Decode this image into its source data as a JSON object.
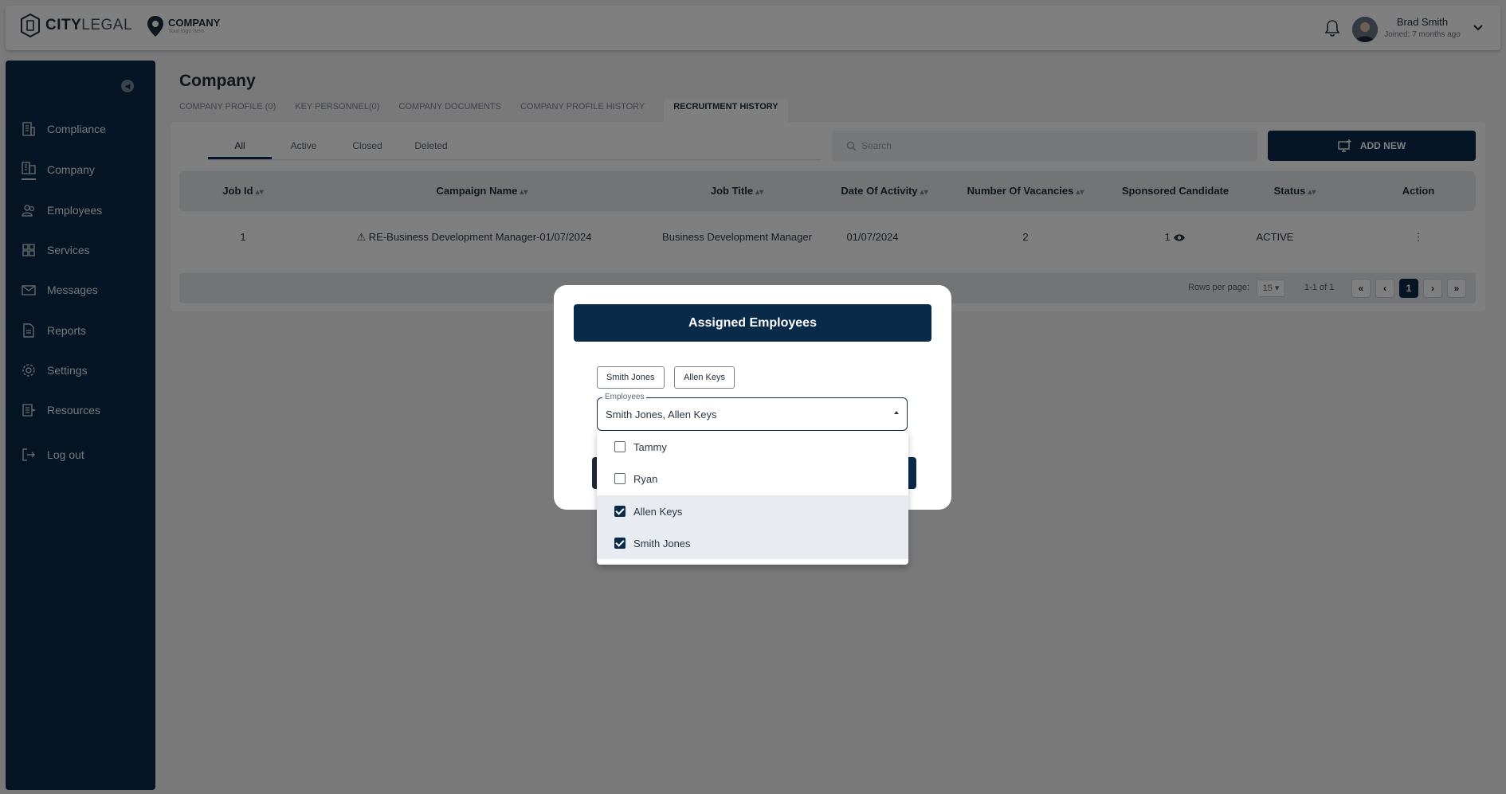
{
  "brand": {
    "name_bold": "CITY",
    "name_light": "LEGAL"
  },
  "company_logo": {
    "name": "COMPANY",
    "tagline": "Your logo here"
  },
  "user": {
    "name": "Brad Smith",
    "joined": "Joined: 7 months ago"
  },
  "sidebar": {
    "items": [
      {
        "label": "Compliance",
        "icon": "compliance-icon"
      },
      {
        "label": "Company",
        "icon": "company-icon"
      },
      {
        "label": "Employees",
        "icon": "employees-icon"
      },
      {
        "label": "Services",
        "icon": "services-icon"
      },
      {
        "label": "Messages",
        "icon": "messages-icon"
      },
      {
        "label": "Reports",
        "icon": "reports-icon"
      },
      {
        "label": "Settings",
        "icon": "settings-icon"
      },
      {
        "label": "Resources",
        "icon": "resources-icon"
      },
      {
        "label": "Log out",
        "icon": "logout-icon"
      }
    ],
    "active": "Company"
  },
  "page": {
    "title": "Company",
    "tabs": [
      "COMPANY PROFILE (0)",
      "KEY PERSONNEL(0)",
      "COMPANY DOCUMENTS",
      "COMPANY PROFILE HISTORY",
      "RECRUITMENT HISTORY"
    ],
    "active_tab": "RECRUITMENT HISTORY"
  },
  "filters": {
    "tabs": [
      "All",
      "Active",
      "Closed",
      "Deleted"
    ],
    "active": "All",
    "search_placeholder": "Search",
    "add_new_label": "ADD NEW"
  },
  "table": {
    "columns": [
      "Job Id",
      "Campaign Name",
      "Job Title",
      "Date Of Activity",
      "Number Of Vacancies",
      "Sponsored Candidate",
      "Status",
      "Action"
    ],
    "rows": [
      {
        "job_id": "1",
        "campaign_name": "RE-Business Development Manager-01/07/2024",
        "job_title": "Business Development Manager",
        "date_of_activity": "01/07/2024",
        "vacancies": "2",
        "sponsored": "1",
        "status": "ACTIVE"
      }
    ]
  },
  "pagination": {
    "rows_per_page_label": "Rows per page:",
    "rows_per_page": "15",
    "range": "1-1 of 1",
    "current_page": "1"
  },
  "modal": {
    "title": "Assigned Employees",
    "chips": [
      "Smith Jones",
      "Allen Keys"
    ],
    "field_label": "Employees",
    "field_value": "Smith Jones, Allen Keys",
    "options": [
      {
        "label": "Tammy",
        "checked": false
      },
      {
        "label": "Ryan",
        "checked": false
      },
      {
        "label": "Allen Keys",
        "checked": true
      },
      {
        "label": "Smith Jones",
        "checked": true
      }
    ]
  },
  "colors": {
    "primary": "#0a2a4a",
    "overlay": "rgba(0,0,0,0.5)"
  }
}
